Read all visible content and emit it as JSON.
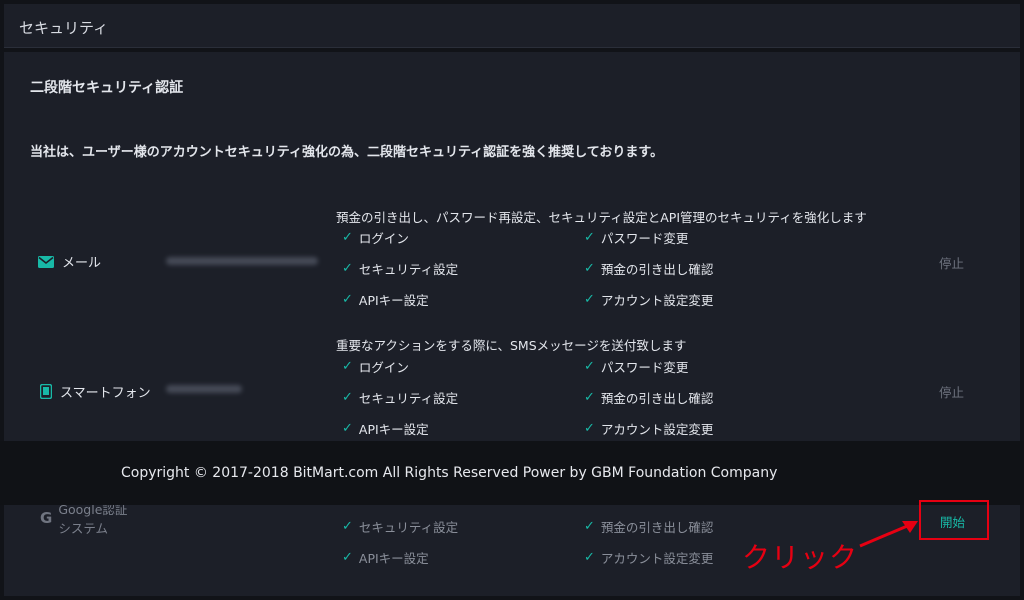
{
  "header": {
    "title": "セキュリティ"
  },
  "section": {
    "title": "二段階セキュリティ認証",
    "intro": "当社は、ユーザー様のアカウントセキュリティ強化の為、二段階セキュリティ認証を強く推奨しております。"
  },
  "email": {
    "label": "メール",
    "description": "預金の引き出し、パスワード再設定、セキュリティ設定とAPI管理のセキュリティを強化します",
    "features": [
      "ログイン",
      "パスワード変更",
      "セキュリティ設定",
      "預金の引き出し確認",
      "APIキー設定",
      "アカウント設定変更"
    ],
    "action": "停止"
  },
  "phone": {
    "label": "スマートフォン",
    "description": "重要なアクションをする際に、SMSメッセージを送付致します",
    "features": [
      "ログイン",
      "パスワード変更",
      "セキュリティ設定",
      "預金の引き出し確認",
      "APIキー設定",
      "アカウント設定変更"
    ],
    "action": "停止"
  },
  "google": {
    "label_line1": "Google認証",
    "label_line2": "システム",
    "features": [
      "セキュリティ設定",
      "預金の引き出し確認",
      "APIキー設定",
      "アカウント設定変更"
    ],
    "action": "開始"
  },
  "footer": {
    "copyright": "Copyright © 2017-2018 BitMart.com All Rights Reserved Power by GBM Foundation Company"
  },
  "annotation": {
    "text": "クリック"
  },
  "colors": {
    "accent": "#18b9a7",
    "highlight": "#e60012",
    "panel": "#1c1f28"
  },
  "icons": {
    "email": "mail-icon",
    "phone": "phone-icon",
    "google": "google-icon",
    "check": "check-icon"
  }
}
